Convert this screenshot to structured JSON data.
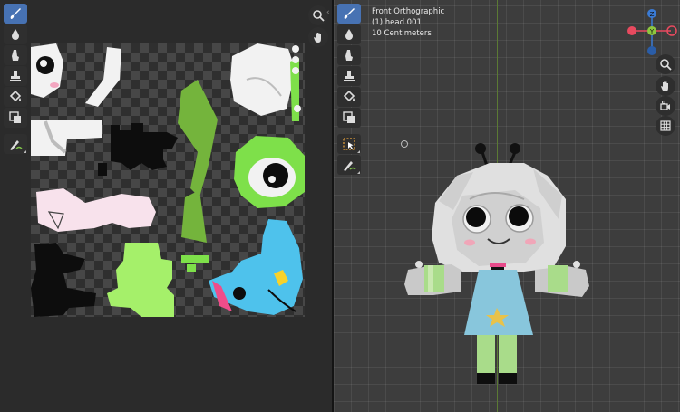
{
  "uv_editor": {
    "tools": [
      "paint-brush",
      "blur",
      "smear",
      "clone",
      "fill",
      "mask",
      "annotate"
    ],
    "navigation": [
      "zoom",
      "pan"
    ]
  },
  "viewport": {
    "view_name": "Front Orthographic",
    "object_name": "(1) head.001",
    "grid_scale": "10 Centimeters",
    "tools": [
      "paint-brush",
      "blur",
      "smear",
      "clone",
      "fill",
      "mask",
      "select-box",
      "annotate"
    ],
    "navigation": [
      "zoom",
      "pan",
      "camera",
      "grid"
    ],
    "gizmo": {
      "labels": {
        "z": "Z",
        "y": "Y"
      },
      "colors": {
        "x": "#e84a5f",
        "y": "#8dc63f",
        "z": "#3a7bd5"
      }
    }
  },
  "colors": {
    "active_tool": "#4772b3",
    "panel_bg": "#2b2b2b",
    "viewport_bg": "#3d3d3d"
  }
}
